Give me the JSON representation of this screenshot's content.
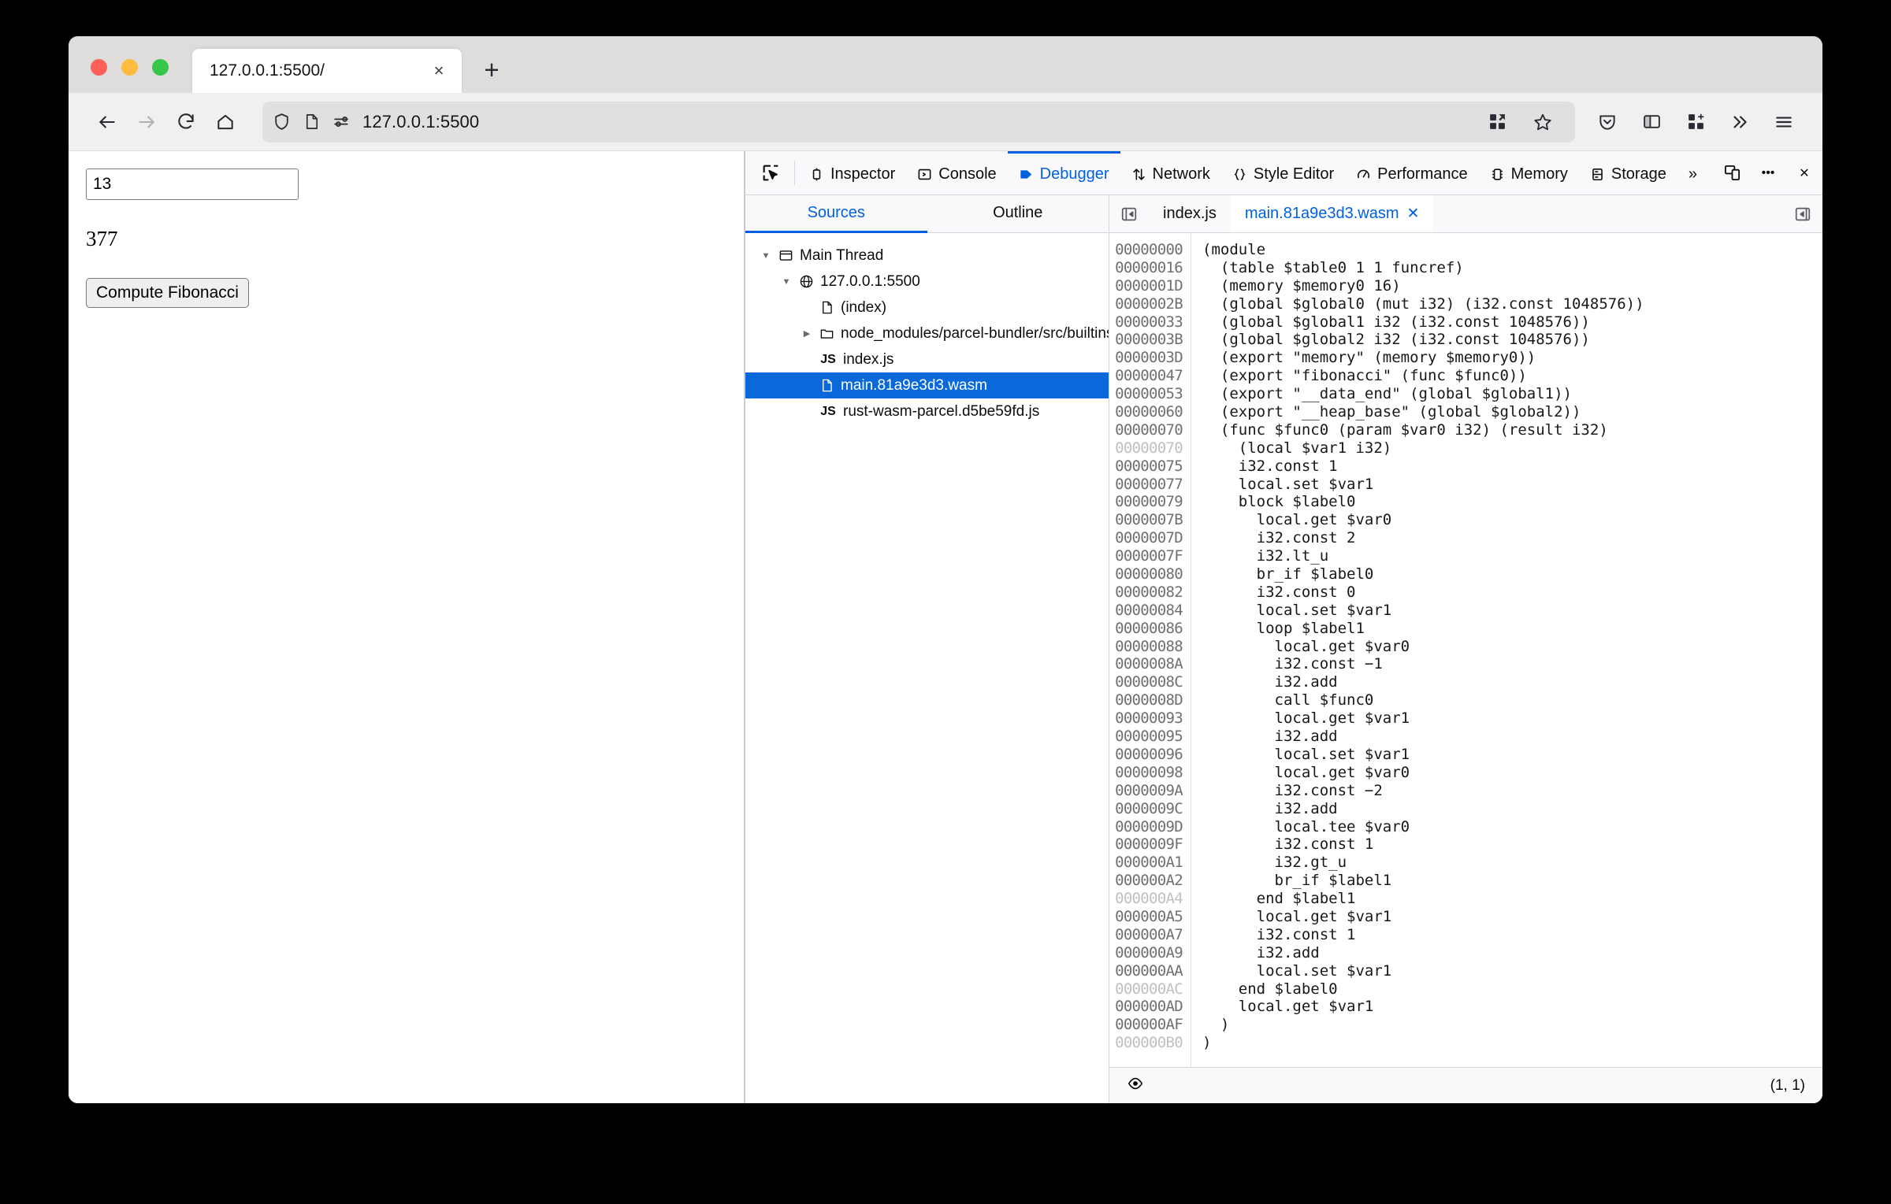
{
  "window": {
    "traffic_lights": [
      "close",
      "minimize",
      "zoom"
    ]
  },
  "tab": {
    "title": "127.0.0.1:5500/",
    "close_label": "×",
    "new_tab_label": "+"
  },
  "nav": {
    "back_icon": "back-arrow-icon",
    "forward_icon": "forward-arrow-icon",
    "reload_icon": "reload-icon",
    "home_icon": "home-icon",
    "url": "127.0.0.1:5500",
    "shield_icon": "shield-icon",
    "page_icon": "page-icon",
    "permissions_icon": "permissions-icon",
    "extension_icon": "extensions-grid-icon",
    "bookmark_icon": "star-icon",
    "pocket_icon": "pocket-icon",
    "sidebar_icon": "sidebar-icon",
    "addons_icon": "addons-icon",
    "overflow_icon": "chevrons-right-icon",
    "menu_icon": "hamburger-menu-icon"
  },
  "page": {
    "input_value": "13",
    "input_placeholder": "",
    "result": "377",
    "button_label": "Compute Fibonacci"
  },
  "devtools": {
    "picker_icon": "element-picker-icon",
    "tabs": [
      {
        "label": "Inspector",
        "icon": "inspector-icon",
        "active": false
      },
      {
        "label": "Console",
        "icon": "console-icon",
        "active": false
      },
      {
        "label": "Debugger",
        "icon": "debugger-icon",
        "active": true
      },
      {
        "label": "Network",
        "icon": "network-icon",
        "active": false
      },
      {
        "label": "Style Editor",
        "icon": "style-editor-icon",
        "active": false
      },
      {
        "label": "Performance",
        "icon": "performance-icon",
        "active": false
      },
      {
        "label": "Memory",
        "icon": "memory-icon",
        "active": false
      },
      {
        "label": "Storage",
        "icon": "storage-icon",
        "active": false
      }
    ],
    "overflow_label": "»",
    "responsive_icon": "responsive-design-mode-icon",
    "meatball_label": "•••",
    "close_label": "✕",
    "sources_tabs": [
      {
        "label": "Sources",
        "active": true
      },
      {
        "label": "Outline",
        "active": false
      }
    ],
    "tree": [
      {
        "label": "Main Thread",
        "depth": 0,
        "twisty": "down",
        "icon": "thread-icon",
        "selected": false
      },
      {
        "label": "127.0.0.1:5500",
        "depth": 1,
        "twisty": "down",
        "icon": "globe-icon",
        "selected": false
      },
      {
        "label": "(index)",
        "depth": 2,
        "twisty": "none",
        "icon": "file-icon",
        "selected": false
      },
      {
        "label": "node_modules/parcel-bundler/src/builtins",
        "depth": 2,
        "twisty": "right",
        "icon": "folder-icon",
        "selected": false
      },
      {
        "label": "index.js",
        "depth": 2,
        "twisty": "none",
        "icon": "js-icon",
        "selected": false
      },
      {
        "label": "main.81a9e3d3.wasm",
        "depth": 2,
        "twisty": "none",
        "icon": "file-icon",
        "selected": true
      },
      {
        "label": "rust-wasm-parcel.d5be59fd.js",
        "depth": 2,
        "twisty": "none",
        "icon": "js-icon",
        "selected": false
      }
    ],
    "editor_toggle_icon": "collapse-sidebar-icon",
    "editor_right_toggle_icon": "expand-sidebar-icon",
    "editor_tabs": [
      {
        "label": "index.js",
        "active": false,
        "closable": false
      },
      {
        "label": "main.81a9e3d3.wasm",
        "active": true,
        "closable": true,
        "close_label": "✕"
      }
    ],
    "status": {
      "breakpoint_icon": "eye-icon",
      "cursor": "(1, 1)"
    },
    "code_lines": [
      {
        "offset": "00000000",
        "dim": false,
        "text": "(module"
      },
      {
        "offset": "00000016",
        "dim": false,
        "text": "  (table $table0 1 1 funcref)"
      },
      {
        "offset": "0000001D",
        "dim": false,
        "text": "  (memory $memory0 16)"
      },
      {
        "offset": "0000002B",
        "dim": false,
        "text": "  (global $global0 (mut i32) (i32.const 1048576))"
      },
      {
        "offset": "00000033",
        "dim": false,
        "text": "  (global $global1 i32 (i32.const 1048576))"
      },
      {
        "offset": "0000003B",
        "dim": false,
        "text": "  (global $global2 i32 (i32.const 1048576))"
      },
      {
        "offset": "0000003D",
        "dim": false,
        "text": "  (export \"memory\" (memory $memory0))"
      },
      {
        "offset": "00000047",
        "dim": false,
        "text": "  (export \"fibonacci\" (func $func0))"
      },
      {
        "offset": "00000053",
        "dim": false,
        "text": "  (export \"__data_end\" (global $global1))"
      },
      {
        "offset": "00000060",
        "dim": false,
        "text": "  (export \"__heap_base\" (global $global2))"
      },
      {
        "offset": "00000070",
        "dim": false,
        "text": "  (func $func0 (param $var0 i32) (result i32)"
      },
      {
        "offset": "00000070",
        "dim": true,
        "text": "    (local $var1 i32)"
      },
      {
        "offset": "00000075",
        "dim": false,
        "text": "    i32.const 1"
      },
      {
        "offset": "00000077",
        "dim": false,
        "text": "    local.set $var1"
      },
      {
        "offset": "00000079",
        "dim": false,
        "text": "    block $label0"
      },
      {
        "offset": "0000007B",
        "dim": false,
        "text": "      local.get $var0"
      },
      {
        "offset": "0000007D",
        "dim": false,
        "text": "      i32.const 2"
      },
      {
        "offset": "0000007F",
        "dim": false,
        "text": "      i32.lt_u"
      },
      {
        "offset": "00000080",
        "dim": false,
        "text": "      br_if $label0"
      },
      {
        "offset": "00000082",
        "dim": false,
        "text": "      i32.const 0"
      },
      {
        "offset": "00000084",
        "dim": false,
        "text": "      local.set $var1"
      },
      {
        "offset": "00000086",
        "dim": false,
        "text": "      loop $label1"
      },
      {
        "offset": "00000088",
        "dim": false,
        "text": "        local.get $var0"
      },
      {
        "offset": "0000008A",
        "dim": false,
        "text": "        i32.const −1"
      },
      {
        "offset": "0000008C",
        "dim": false,
        "text": "        i32.add"
      },
      {
        "offset": "0000008D",
        "dim": false,
        "text": "        call $func0"
      },
      {
        "offset": "00000093",
        "dim": false,
        "text": "        local.get $var1"
      },
      {
        "offset": "00000095",
        "dim": false,
        "text": "        i32.add"
      },
      {
        "offset": "00000096",
        "dim": false,
        "text": "        local.set $var1"
      },
      {
        "offset": "00000098",
        "dim": false,
        "text": "        local.get $var0"
      },
      {
        "offset": "0000009A",
        "dim": false,
        "text": "        i32.const −2"
      },
      {
        "offset": "0000009C",
        "dim": false,
        "text": "        i32.add"
      },
      {
        "offset": "0000009D",
        "dim": false,
        "text": "        local.tee $var0"
      },
      {
        "offset": "0000009F",
        "dim": false,
        "text": "        i32.const 1"
      },
      {
        "offset": "000000A1",
        "dim": false,
        "text": "        i32.gt_u"
      },
      {
        "offset": "000000A2",
        "dim": false,
        "text": "        br_if $label1"
      },
      {
        "offset": "000000A4",
        "dim": true,
        "text": "      end $label1"
      },
      {
        "offset": "000000A5",
        "dim": false,
        "text": "      local.get $var1"
      },
      {
        "offset": "000000A7",
        "dim": false,
        "text": "      i32.const 1"
      },
      {
        "offset": "000000A9",
        "dim": false,
        "text": "      i32.add"
      },
      {
        "offset": "000000AA",
        "dim": false,
        "text": "      local.set $var1"
      },
      {
        "offset": "000000AC",
        "dim": true,
        "text": "    end $label0"
      },
      {
        "offset": "000000AD",
        "dim": false,
        "text": "    local.get $var1"
      },
      {
        "offset": "000000AF",
        "dim": false,
        "text": "  )"
      },
      {
        "offset": "000000B0",
        "dim": true,
        "text": ")"
      }
    ]
  },
  "colors": {
    "accent": "#0060df",
    "selection": "#0a69da",
    "chrome": "#f0f0f0",
    "tabstrip": "#dedddb"
  }
}
